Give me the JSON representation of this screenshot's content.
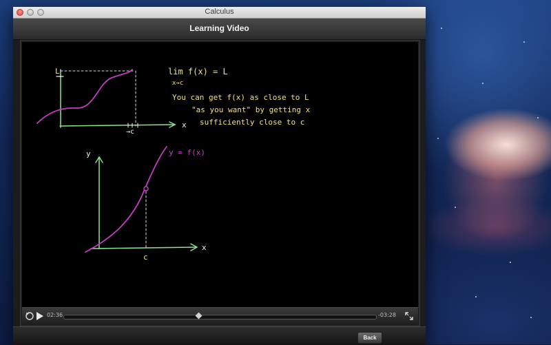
{
  "window": {
    "title": "Calculus"
  },
  "header": {
    "title": "Learning Video"
  },
  "video": {
    "board_text": {
      "limit_line1": "lim f(x) = L",
      "limit_line2": "x→c",
      "note_line1": "You can get f(x) as close to L",
      "note_line2": "\"as you want\" by getting x",
      "note_line3": "sufficiently close to c",
      "func_label": "y = f(x)",
      "axis_x1": "x",
      "axis_x2": "x",
      "axis_y": "y",
      "c_label_top": "→c",
      "c_label_bottom": "c",
      "L_label": "L"
    },
    "colors": {
      "axis": "#8fe38f",
      "curve": "#c43cc4",
      "text_yellow": "#f2e27a",
      "text_white": "#f4f4f4"
    }
  },
  "player": {
    "current_time": "02:36",
    "remaining_time": "-03:28",
    "progress_fraction": 0.43,
    "icons": [
      "replay-icon",
      "play-icon",
      "fullscreen-icon"
    ]
  },
  "footer": {
    "back_label": "Back"
  }
}
